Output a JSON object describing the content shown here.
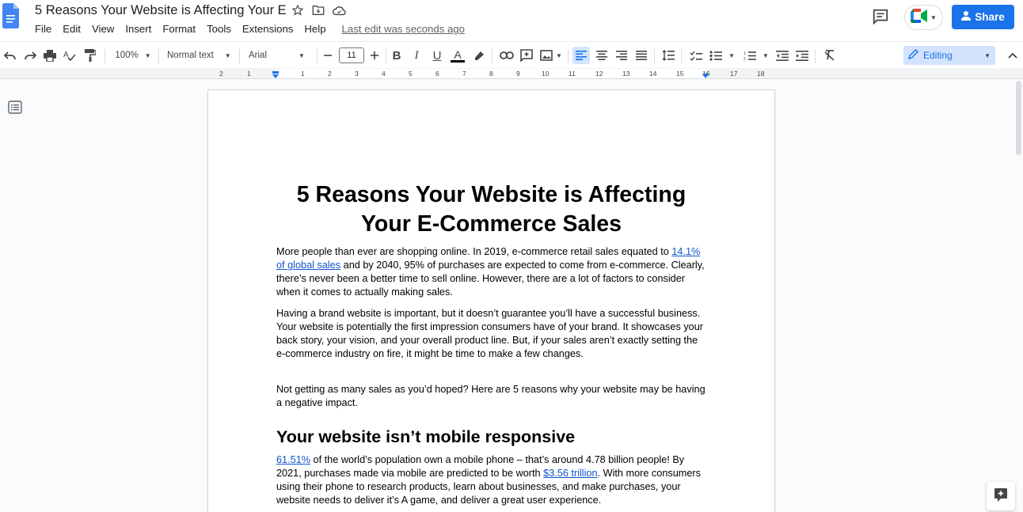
{
  "app": {
    "doc_title": "5 Reasons Your Website is Affecting Your E",
    "menu": [
      "File",
      "Edit",
      "View",
      "Insert",
      "Format",
      "Tools",
      "Extensions",
      "Help"
    ],
    "last_edit": "Last edit was seconds ago",
    "share_label": "Share",
    "accent_color": "#1a73e8"
  },
  "toolbar": {
    "zoom": "100%",
    "style": "Normal text",
    "font": "Arial",
    "font_size": "11",
    "mode": "Editing",
    "icons": [
      "undo-icon",
      "redo-icon",
      "print-icon",
      "spellcheck-icon",
      "paint-format-icon",
      "bold-icon",
      "italic-icon",
      "underline-icon",
      "text-color-icon",
      "highlight-icon",
      "link-icon",
      "comment-icon",
      "image-icon",
      "align-left-icon",
      "align-center-icon",
      "align-right-icon",
      "justify-icon",
      "line-spacing-icon",
      "checklist-icon",
      "bullet-list-icon",
      "numbered-list-icon",
      "decrease-indent-icon",
      "increase-indent-icon",
      "clear-formatting-icon"
    ]
  },
  "ruler": {
    "ticks": [
      "2",
      "1",
      "1",
      "2",
      "3",
      "4",
      "5",
      "6",
      "7",
      "8",
      "9",
      "10",
      "11",
      "12",
      "13",
      "14",
      "15",
      "16",
      "17",
      "18"
    ]
  },
  "document": {
    "title": "5 Reasons Your Website is Affecting Your E-Commerce Sales",
    "p1_a": "More people than ever are shopping online. In 2019, e-commerce retail sales equated to ",
    "p1_link": "14.1% of global sales",
    "p1_b": " and by 2040, 95% of purchases are expected to come from e-commerce. Clearly, there’s never been a better time to sell online. However, there are a lot of factors to consider when it comes to actually making sales.",
    "p2": "Having a brand website is important, but it doesn’t guarantee you’ll have a successful business. Your website is potentially the first impression consumers have of your brand. It showcases your back story, your vision, and your overall product line. But, if your sales aren’t exactly setting the e-commerce industry on fire, it might be time to make a few changes.",
    "p3": "Not getting as many sales as you’d hoped? Here are 5 reasons why your website may be having a negative impact.",
    "h2": "Your website isn’t mobile responsive",
    "p4_link1": "61.51%",
    "p4_a": " of the world’s population own a mobile phone – that’s around 4.78 billion people! By 2021, purchases made via mobile are predicted to be worth ",
    "p4_link2": "$3.56 trillion",
    "p4_b": ". With more consumers using their phone to research products, learn about businesses, and make purchases, your website needs to deliver it’s A game, and deliver a great user experience."
  }
}
